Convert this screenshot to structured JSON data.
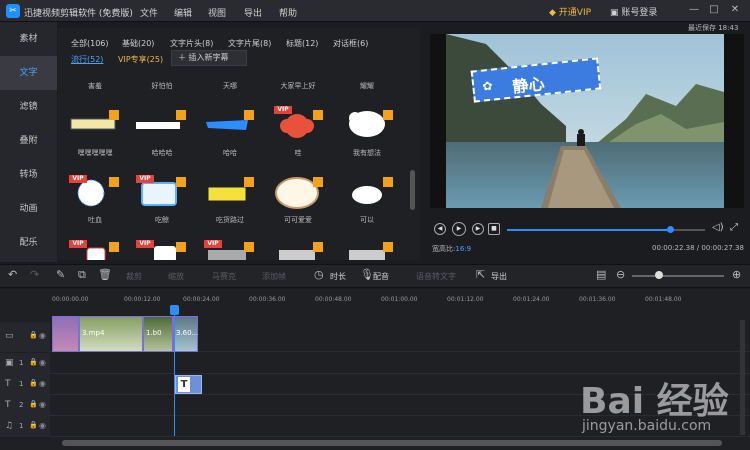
{
  "titlebar": {
    "logo_glyph": "✂",
    "title": "迅捷视频剪辑软件 (免费版)",
    "menu": [
      "文件",
      "编辑",
      "视图",
      "导出",
      "帮助"
    ],
    "vip": "开通VIP",
    "login": "账号登录",
    "min": "—",
    "max": "□",
    "close": "✕"
  },
  "autosave": "最近保存 18:43",
  "sidebar": [
    "素材",
    "文字",
    "滤镜",
    "叠附",
    "转场",
    "动画",
    "配乐"
  ],
  "library": {
    "categories": [
      "全部(106)",
      "基础(20)",
      "文字片头(8)",
      "文字片尾(8)",
      "标题(12)",
      "对话框(6)"
    ],
    "tab_popular": "流行(52)",
    "tab_vip": "VIP专享(25)",
    "insert": "插入新字幕",
    "row1_labels": [
      "害羞",
      "好怕怕",
      "天哪",
      "大家早上好",
      "耀耀"
    ],
    "row2_labels": [
      "嘿嘿嘿嘿嘿",
      "哈哈哈",
      "哈哈",
      "哇",
      "我有想法"
    ],
    "row3_labels": [
      "吐血",
      "吃鲸",
      "吃货路过",
      "可可爱爱",
      "可以"
    ],
    "vip_badge": "VIP"
  },
  "preview": {
    "caption": "静心",
    "ratio_label": "宽高比:",
    "ratio_value": "16:9",
    "time": "00:00:22.38 / 00:00:27.38"
  },
  "toolbar": {
    "cut": "裁剪",
    "rotate": "缩放",
    "mosaic": "马赛克",
    "zoom": "添加帧",
    "duration": "时长",
    "dub": "配音",
    "speech": "语音转文字",
    "export": "导出"
  },
  "timeline": {
    "ticks": [
      "00:00:00.00",
      "00:00:12.00",
      "00:00:24.00",
      "00:00:36.00",
      "00:00:48.00",
      "00:01:00.00",
      "00:01:12.00",
      "00:01:24.00",
      "00:01:36.00",
      "00:01:48.00"
    ],
    "tracks": [
      {
        "icon": "▭",
        "num": ""
      },
      {
        "icon": "▣",
        "num": "1"
      },
      {
        "icon": "T",
        "num": "1"
      },
      {
        "icon": "T",
        "num": "2"
      },
      {
        "icon": "♫",
        "num": "1"
      }
    ],
    "clip1": "3.mp4",
    "clip2": "1.b0",
    "clip3": "3.60...",
    "text_clip": "T"
  },
  "watermark": {
    "brand": "Bai 经验",
    "site": "jingyan.baidu.com"
  }
}
